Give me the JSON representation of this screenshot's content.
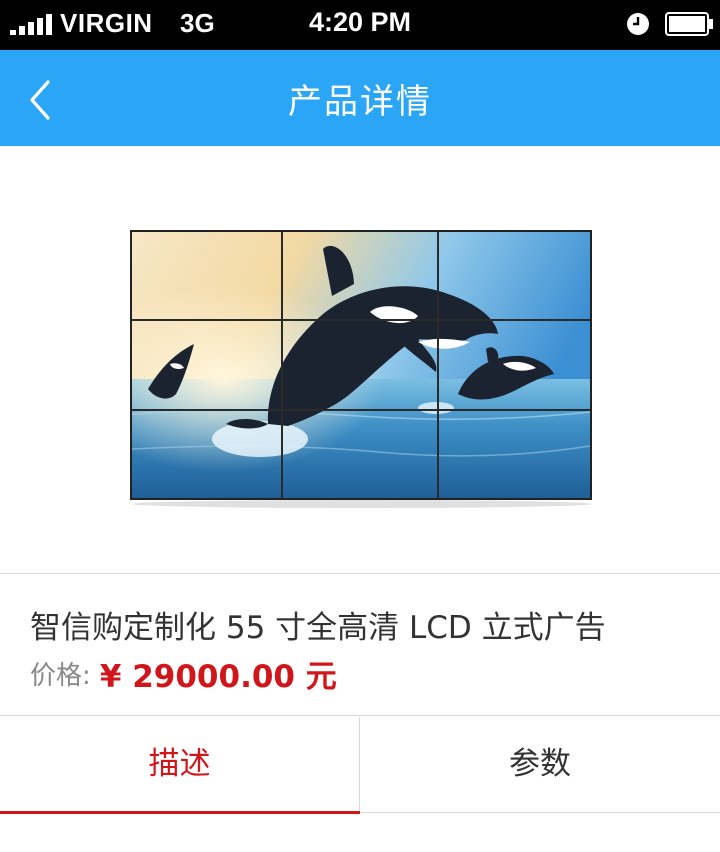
{
  "status_bar": {
    "carrier": "VIRGIN",
    "network": "3G",
    "time": "4:20 PM",
    "icons": [
      "signal-icon",
      "alarm-clock-icon",
      "battery-icon"
    ]
  },
  "nav": {
    "title": "产品详情",
    "back_icon": "chevron-left-icon",
    "background_color": "#2ba6f6"
  },
  "product": {
    "image_alt": "video wall with orcas leaping from the sea",
    "title": "智信购定制化 55 寸全高清 LCD 立式广告",
    "price_label": "价格:",
    "price_value": "¥ 29000.00 元",
    "price_color": "#d0161b"
  },
  "tabs": [
    {
      "label": "描述",
      "active": true
    },
    {
      "label": "参数",
      "active": false
    }
  ]
}
